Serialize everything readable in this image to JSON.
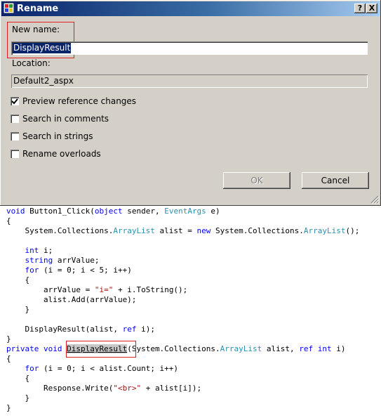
{
  "window": {
    "title": "Rename",
    "help_glyph": "?",
    "close_glyph": "X"
  },
  "form": {
    "new_name_label": "New name:",
    "new_name_value": "DisplayResult",
    "location_label": "Location:",
    "location_value": "Default2_aspx"
  },
  "options": [
    {
      "label": "Preview reference changes",
      "checked": true
    },
    {
      "label": "Search in comments",
      "checked": false
    },
    {
      "label": "Search in strings",
      "checked": false
    },
    {
      "label": "Rename overloads",
      "checked": false
    }
  ],
  "buttons": {
    "ok": "OK",
    "cancel": "Cancel"
  },
  "code": {
    "l1_kw": "void",
    "l1_a": " Button1_Click(",
    "l1_kw2": "object",
    "l1_b": " sender, ",
    "l1_ty": "EventArgs",
    "l1_c": " e)",
    "l2": "{",
    "l3_a": "    System.Collections.",
    "l3_ty": "ArrayList",
    "l3_b": " alist = ",
    "l3_kw": "new",
    "l3_c": " System.Collections.",
    "l3_ty2": "ArrayList",
    "l3_d": "();",
    "l5_a": "    ",
    "l5_kw": "int",
    "l5_b": " i;",
    "l6_a": "    ",
    "l6_kw": "string",
    "l6_b": " arrValue;",
    "l7_a": "    ",
    "l7_kw": "for",
    "l7_b": " (i = 0; i < 5; i++)",
    "l8": "    {",
    "l9_a": "        arrValue = ",
    "l9_str": "\"i=\"",
    "l9_b": " + i.ToString();",
    "l10": "        alist.Add(arrValue);",
    "l11": "    }",
    "l13_a": "    DisplayResult(alist, ",
    "l13_kw": "ref",
    "l13_b": " i);",
    "l14": "}",
    "l15_kw": "private",
    "l15_sp": " ",
    "l15_kw2": "void",
    "l15_sp2": " ",
    "l15_hl": "DisplayResult",
    "l15_a": "(System.Collections.",
    "l15_ty": "ArrayList",
    "l15_b": " alist, ",
    "l15_kw3": "ref",
    "l15_sp3": " ",
    "l15_kw4": "int",
    "l15_c": " i)",
    "l16": "{",
    "l17_a": "    ",
    "l17_kw": "for",
    "l17_b": " (i = 0; i < alist.Count; i++)",
    "l18": "    {",
    "l19_a": "        Response.Write(",
    "l19_str": "\"<br>\"",
    "l19_b": " + alist[i]);",
    "l20": "    }",
    "l21": "}"
  }
}
